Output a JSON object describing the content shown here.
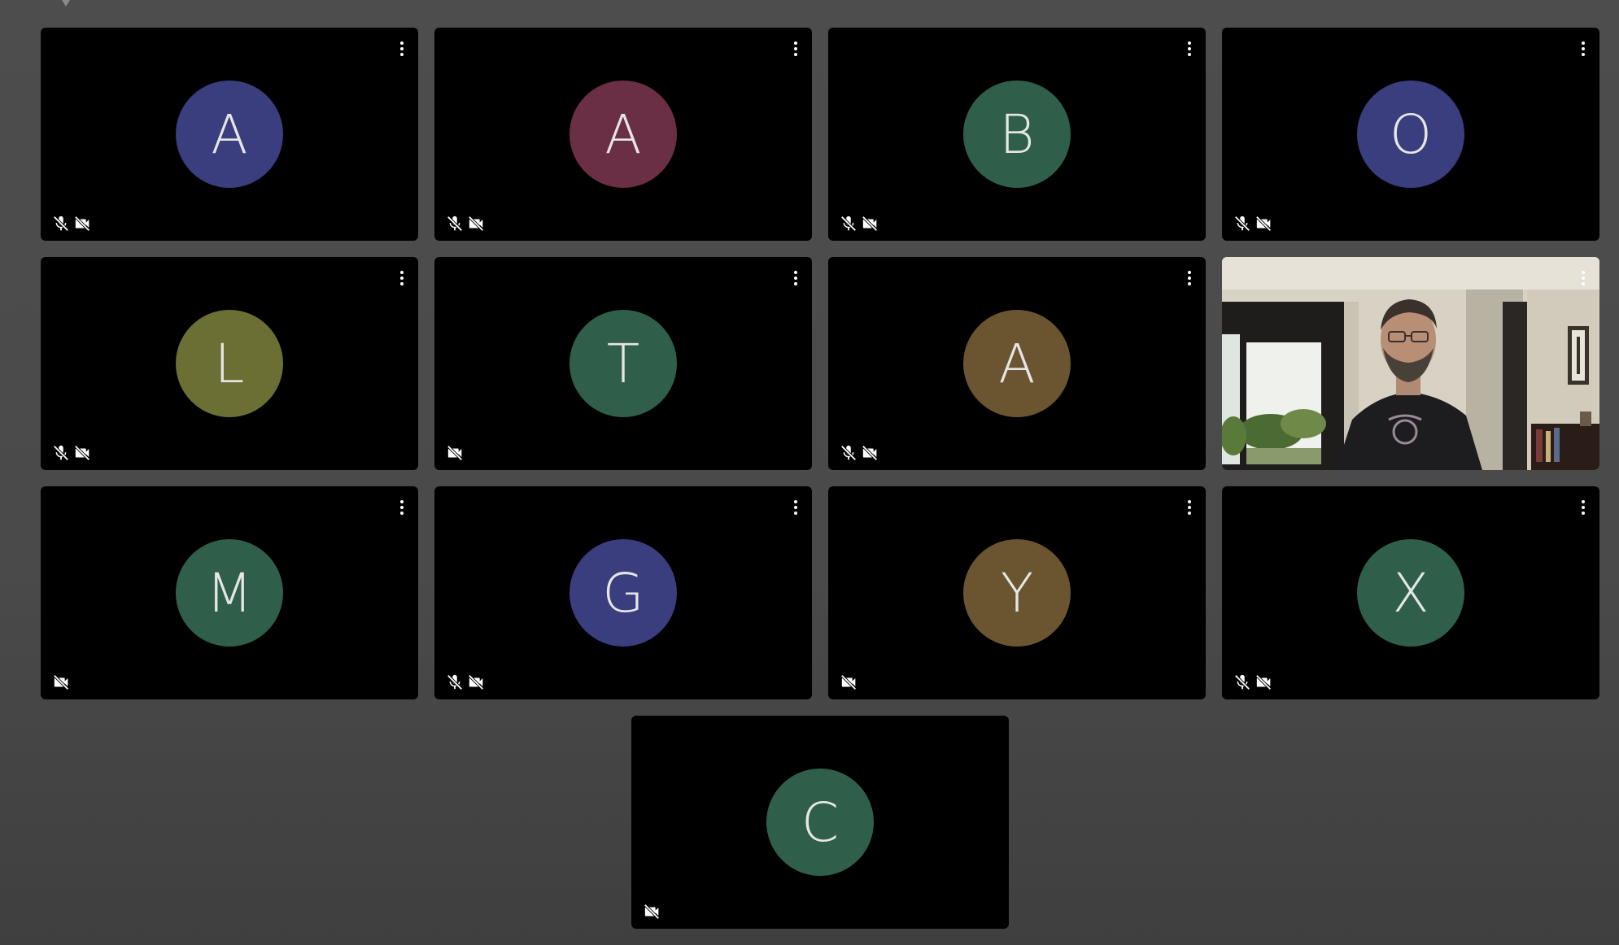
{
  "participants": [
    {
      "initial": "A",
      "color": "#3a3d7e",
      "mic_muted": true,
      "cam_off": true
    },
    {
      "initial": "A",
      "color": "#6a2f45",
      "mic_muted": true,
      "cam_off": true
    },
    {
      "initial": "B",
      "color": "#2f5f4b",
      "mic_muted": true,
      "cam_off": true
    },
    {
      "initial": "O",
      "color": "#3a3d7e",
      "mic_muted": true,
      "cam_off": true
    },
    {
      "initial": "L",
      "color": "#6b6f33",
      "mic_muted": true,
      "cam_off": true
    },
    {
      "initial": "T",
      "color": "#2f5f4b",
      "mic_muted": false,
      "cam_off": true
    },
    {
      "initial": "A",
      "color": "#6b5530",
      "mic_muted": true,
      "cam_off": true
    },
    {
      "initial": "",
      "color": "#000000",
      "mic_muted": false,
      "cam_off": false,
      "video": true
    },
    {
      "initial": "M",
      "color": "#2f5f4b",
      "mic_muted": false,
      "cam_off": true
    },
    {
      "initial": "G",
      "color": "#3a3d7e",
      "mic_muted": true,
      "cam_off": true
    },
    {
      "initial": "Y",
      "color": "#6b5530",
      "mic_muted": false,
      "cam_off": true
    },
    {
      "initial": "X",
      "color": "#2f5f4b",
      "mic_muted": true,
      "cam_off": true
    },
    {
      "initial": "C",
      "color": "#2f5f4b",
      "mic_muted": false,
      "cam_off": true,
      "no_menu": true
    }
  ],
  "icons": {
    "more": "more-vert-icon",
    "mic_off": "mic-off-icon",
    "cam_off": "videocam-off-icon"
  }
}
